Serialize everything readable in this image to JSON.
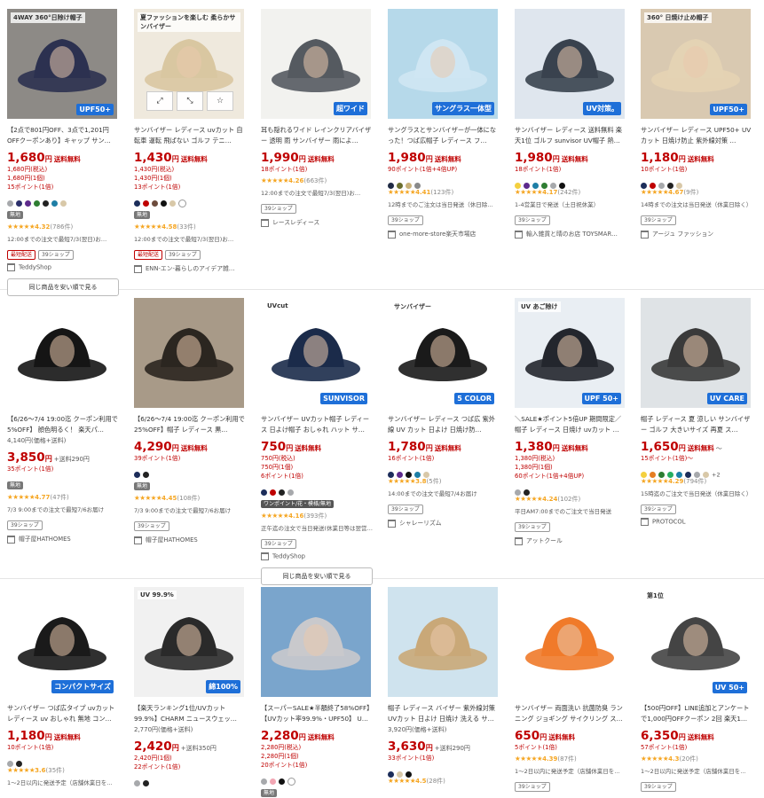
{
  "ui": {
    "same_product_button": "同じ商品を安い順で見る",
    "shipping_label": "送料無料",
    "yen": "円",
    "overlay_icons": [
      "expand-icon",
      "shrink-icon",
      "favorite-star-icon"
    ]
  },
  "products": [
    {
      "title": "【2点で801円OFF、3点で1,201円OFFクーポンあり】キャップ サン…",
      "price": "1,680",
      "orig": "1,680円(税込)",
      "sub": "1,680円(1個)",
      "points": "15ポイント(1倍)",
      "swatches": [
        "#a7a9ac",
        "#2b2f6b",
        "#5d2a8c",
        "#2e7d32",
        "#222222",
        "#1e7fa6",
        "#d8c8a8"
      ],
      "tags": [
        {
          "t": "無地",
          "c": "gray"
        }
      ],
      "stars": "★★★★★",
      "rating": "4.32",
      "count": "(786件)",
      "note": "12:00までの注文で最短7/3(翌日)お…",
      "tags2": [
        {
          "t": "最短配送",
          "c": "red"
        },
        {
          "t": "39ショップ",
          "c": "border"
        }
      ],
      "shop": "TeddyShop",
      "badge": "UPF50+",
      "badge2": "4WAY 360°日除け帽子",
      "bg": "#8d8a86",
      "hat": "#2c3150",
      "button": true
    },
    {
      "title": "サンバイザー レディース uvカット 自転車 運転 飛ばない ゴルフ テニ…",
      "price": "1,430",
      "orig": "1,430円(税込)",
      "sub": "1,430円(1個)",
      "points": "13ポイント(1倍)",
      "swatches": [
        "#1c2d5a",
        "#bf0000",
        "#6d4c3d",
        "#111111",
        "#d8c8a8",
        "#ffffff"
      ],
      "tags": [
        {
          "t": "無地",
          "c": "gray"
        }
      ],
      "stars": "★★★★★",
      "rating": "4.58",
      "count": "(33件)",
      "note": "12:00までの注文で最短7/3(翌日)お…",
      "tags2": [
        {
          "t": "最短配送",
          "c": "red"
        },
        {
          "t": "39ショップ",
          "c": "border"
        }
      ],
      "shop": "ENN-エン-暮らしのアイデア雑…",
      "badge": "",
      "badge2": "夏ファッションを楽しむ 柔らかサンバイザー",
      "bg": "#efe9dd",
      "hat": "#d9c7a1",
      "overlay": true
    },
    {
      "title": "耳も隠れるワイド レインクリアバイザー 透明 雨 サンバイザー 雨によ…",
      "price": "1,990",
      "orig": "",
      "sub": "",
      "points": "18ポイント(1倍)",
      "swatches": [],
      "tags": [],
      "stars": "★★★★★",
      "rating": "4.26",
      "count": "(663件)",
      "note": "12:00までの注文で最短7/3(翌日)お…",
      "tags2": [
        {
          "t": "39ショップ",
          "c": "border"
        }
      ],
      "shop": "レースレディース",
      "badge": "超ワイド",
      "badge2": "",
      "bg": "#f2f2ef",
      "hat": "#555a60"
    },
    {
      "title": "サングラスとサンバイザーが一体になった！つば広帽子 レディース フ…",
      "price": "1,980",
      "orig": "",
      "sub": "",
      "points": "90ポイント(1倍+4倍UP)",
      "swatches": [
        "#1f2a44",
        "#6b6f2f",
        "#c8b17a",
        "#8a8a8a"
      ],
      "tags": [],
      "stars": "★★★★★",
      "rating": "4.41",
      "count": "(123件)",
      "note": "12時までのご注文は当日発送（休日除…",
      "tags2": [
        {
          "t": "39ショップ",
          "c": "border"
        }
      ],
      "shop": "one-more-store楽天市場店",
      "badge": "サングラス一体型",
      "badge2": "",
      "bg": "#b6d9ea",
      "hat": "#cfe6f3"
    },
    {
      "title": "サンバイザー レディース 送料無料 楽天1位 ゴルフ sunvisor UV帽子 熱…",
      "price": "1,980",
      "orig": "",
      "sub": "",
      "points": "18ポイント(1倍)",
      "swatches": [
        "#f4d03f",
        "#5d2a8c",
        "#1e7fa6",
        "#2e7d32",
        "#a7a9ac",
        "#111111"
      ],
      "tags": [],
      "stars": "★★★★★",
      "rating": "4.17",
      "count": "(242件)",
      "note": "1-4営業日で発送（土日祝休業）",
      "tags2": [
        {
          "t": "39ショップ",
          "c": "border"
        }
      ],
      "shop": "輸入雑貨と晴のお店 TOYSMAR…",
      "badge": "UV対策。",
      "badge2": "",
      "bg": "#dfe6ee",
      "hat": "#39424e"
    },
    {
      "title": "サンバイザー レディース UPF50+ UVカット 日焼け防止 紫外線対策 …",
      "price": "1,180",
      "orig": "",
      "sub": "",
      "points": "10ポイント(1倍)",
      "swatches": [
        "#1c2d5a",
        "#bf0000",
        "#a7a9ac",
        "#222222",
        "#d8c8a8"
      ],
      "tags": [],
      "stars": "★★★★★",
      "rating": "4.67",
      "count": "(9件)",
      "note": "14時までの注文は当日発送（休業日除く）",
      "tags2": [
        {
          "t": "39ショップ",
          "c": "border"
        }
      ],
      "shop": "アージュ ファッション",
      "badge": "UPF50+",
      "badge2": "360° 日焼け止め帽子",
      "bg": "#d9c9b1",
      "hat": "#e4d3b4"
    },
    {
      "title": "【6/26～7/4 19:00迄 クーポン利用で 5%OFF】 顔色明るく！ 楽天パ…",
      "price": "3,850",
      "orig": "4,140円(価格+送料)",
      "sub": "",
      "extra": "+送料290円",
      "points": "35ポイント(1倍)",
      "swatches": [],
      "tags": [
        {
          "t": "無地",
          "c": "gray"
        }
      ],
      "stars": "★★★★★",
      "rating": "4.77",
      "count": "(47件)",
      "note": "7/3 9:00までの注文で最短7/6お届け",
      "tags2": [
        {
          "t": "39ショップ",
          "c": "border"
        }
      ],
      "shop": "帽子屋HATHOMES",
      "badge": "",
      "badge2": "",
      "bg": "#ffffff",
      "hat": "#151515",
      "noship": true
    },
    {
      "title": "【6/26～7/4 19:00迄 クーポン利用で 25%OFF】帽子 レディース 黒…",
      "price": "4,290",
      "orig": "",
      "sub": "",
      "points": "39ポイント(1倍)",
      "swatches": [
        "#1c2d5a",
        "#222222"
      ],
      "tags": [
        {
          "t": "無地",
          "c": "gray"
        }
      ],
      "stars": "★★★★★",
      "rating": "4.45",
      "count": "(108件)",
      "note": "7/3 9:00までの注文で最短7/6お届け",
      "tags2": [
        {
          "t": "39ショップ",
          "c": "border"
        }
      ],
      "shop": "帽子屋HATHOMES",
      "badge": "",
      "badge2": "",
      "bg": "#a89a88",
      "hat": "#2b2620"
    },
    {
      "title": "サンバイザー UVカット帽子 レディース 日よけ帽子 おしゃれ ハット サ…",
      "price": "750",
      "orig": "750円(税込)",
      "sub": "750円(1個)",
      "points": "6ポイント(1倍)",
      "swatches": [
        "#1c2d5a",
        "#bf0000",
        "#222222",
        "#a7a9ac"
      ],
      "tags": [
        {
          "t": "ワンポイント/花・模様/無地",
          "c": "dark"
        }
      ],
      "stars": "★★★★★",
      "rating": "4.16",
      "count": "(393件)",
      "note": "正午迄の注文で当日発送(休業日等は翌営…",
      "tags2": [
        {
          "t": "39ショップ",
          "c": "border"
        }
      ],
      "shop": "TeddyShop",
      "badge": "SUNVISOR",
      "badge2": "UVcut",
      "bg": "#ffffff",
      "hat": "#1b2b4a",
      "button": true
    },
    {
      "title": "サンバイザー レディース つば広 紫外線 UV カット 日よけ 日焼け防…",
      "price": "1,780",
      "orig": "",
      "sub": "",
      "points": "16ポイント(1倍)",
      "swatches": [
        "#1c2d5a",
        "#5d2a8c",
        "#111111",
        "#1e7fa6",
        "#d8c8a8"
      ],
      "tags": [],
      "stars": "★★★★★",
      "rating": "3.8",
      "count": "(5件)",
      "note": "14:00までの注文で最短7/4お届け",
      "tags2": [
        {
          "t": "39ショップ",
          "c": "border"
        }
      ],
      "shop": "シャレーリズム",
      "badge": "5 COLOR",
      "badge2": "サンバイザー",
      "bg": "#ffffff",
      "hat": "#1a1a1a"
    },
    {
      "title": "＼SALE★ポイント5倍UP 期間限定／帽子 レディース 日焼け uvカット …",
      "price": "1,380",
      "orig": "1,380円(税込)",
      "sub": "1,380円(1個)",
      "points": "60ポイント(1倍+4倍UP)",
      "swatches": [
        "#a7a9ac",
        "#222222"
      ],
      "tags": [],
      "stars": "★★★★★",
      "rating": "4.24",
      "count": "(102件)",
      "note": "平日AM7:00までのご注文で当日発送",
      "tags2": [
        {
          "t": "39ショップ",
          "c": "border"
        }
      ],
      "shop": "アットクール",
      "badge": "UPF 50+",
      "badge2": "UV あご除け",
      "bg": "#e9eef3",
      "hat": "#23262d"
    },
    {
      "title": "帽子 レディース 夏 涼しい サンバイザー ゴルフ 大きいサイズ 再夏 ス…",
      "price": "1,650",
      "orig": "",
      "sub": "",
      "extra": "～",
      "points": "15ポイント(1倍)～",
      "swatches": [
        "#f4d03f",
        "#e67e22",
        "#2e7d32",
        "#27ae60",
        "#1e7fa6",
        "#1c2d5a",
        "#a7a9ac",
        "#d8c8a8"
      ],
      "more": "+2",
      "tags": [],
      "stars": "★★★★★",
      "rating": "4.29",
      "count": "(794件)",
      "note": "15時迄のご注文で当日発送（休業日除く）",
      "tags2": [
        {
          "t": "39ショップ",
          "c": "border"
        }
      ],
      "shop": "PROTOCOL",
      "badge": "UV CARE",
      "badge2": "",
      "bg": "#dfe3e6",
      "hat": "#3a3a3a"
    },
    {
      "title": "サンバイザー つば広タイプ uvカット レディース uv おしゃれ 無地 コン…",
      "price": "1,180",
      "orig": "",
      "sub": "",
      "points": "10ポイント(1倍)",
      "swatches": [
        "#a7a9ac",
        "#222222"
      ],
      "tags": [],
      "stars": "★★★★★",
      "rating": "3.6",
      "count": "(35件)",
      "note": "1～2日以内に発送予定（店舗休業日を…",
      "tags2": [],
      "shop": "",
      "badge": "コンパクトサイズ",
      "badge2": "",
      "bg": "#ffffff",
      "hat": "#1a1a1a"
    },
    {
      "title": "【楽天ランキング1位/UVカット99.9%】CHARM ニュースウェッ…",
      "price": "2,420",
      "orig": "2,770円(価格+送料)",
      "sub": "2,420円(1個)",
      "extra": "+送料350円",
      "points": "22ポイント(1倍)",
      "swatches": [
        "#a7a9ac",
        "#222222"
      ],
      "tags": [],
      "stars": "",
      "rating": "",
      "count": "",
      "note": "",
      "tags2": [],
      "shop": "",
      "badge": "綿100%",
      "badge2": "UV 99.9%",
      "bg": "#f1f1f1",
      "hat": "#2a2a2a",
      "noship": true
    },
    {
      "title": "【スーパーSALE★半額終了58%OFF】【UVカット率99.9%・UPF50】 U…",
      "price": "2,280",
      "orig": "2,280円(税込)",
      "sub": "2,280円(1個)",
      "points": "20ポイント(1倍)",
      "swatches": [
        "#a7a9ac",
        "#f2a6b3",
        "#111111",
        "#ffffff"
      ],
      "tags": [
        {
          "t": "無地",
          "c": "gray"
        }
      ],
      "stars": "",
      "rating": "",
      "count": "",
      "note": "",
      "tags2": [],
      "shop": "",
      "badge": "",
      "badge2": "",
      "bg": "#7aa5cc",
      "hat": "#c9c9cc"
    },
    {
      "title": "帽子 レディース バイザー 紫外線対策 UVカット 日よけ 日焼け 洗える サ…",
      "price": "3,630",
      "orig": "3,920円(価格+送料)",
      "sub": "",
      "extra": "+送料290円",
      "points": "33ポイント(1倍)",
      "swatches": [
        "#1c2d5a",
        "#d8c8a8",
        "#111111"
      ],
      "tags": [],
      "stars": "★★★★★",
      "rating": "4.5",
      "count": "(28件)",
      "note": "",
      "tags2": [],
      "shop": "",
      "badge": "",
      "badge2": "",
      "bg": "#cfe3ee",
      "hat": "#c9a878",
      "noship": true
    },
    {
      "title": "サンバイザー 両面洗い 抗菌防臭 ランニング ジョギング サイクリング ス…",
      "price": "650",
      "orig": "",
      "sub": "",
      "points": "5ポイント(1倍)",
      "swatches": [],
      "tags": [],
      "stars": "★★★★★",
      "rating": "4.39",
      "count": "(87件)",
      "note": "1～2日以内に発送予定（店舗休業日を…",
      "tags2": [
        {
          "t": "39ショップ",
          "c": "border"
        }
      ],
      "shop": "",
      "badge": "",
      "badge2": "",
      "bg": "#ffffff",
      "hat": "#f07a2a"
    },
    {
      "title": "【500円OFF】LINE追加とアンケートで1,000円OFFクーポン 2回 楽天1…",
      "price": "6,350",
      "orig": "",
      "sub": "",
      "points": "57ポイント(1倍)",
      "swatches": [],
      "tags": [],
      "stars": "★★★★★",
      "rating": "4.3",
      "count": "(20件)",
      "note": "1～2日以内に発送予定（店舗休業日を…",
      "tags2": [
        {
          "t": "39ショップ",
          "c": "border"
        }
      ],
      "shop": "",
      "badge": "UV 50+",
      "badge2": "第1位",
      "bg": "#ffffff",
      "hat": "#444444"
    }
  ]
}
